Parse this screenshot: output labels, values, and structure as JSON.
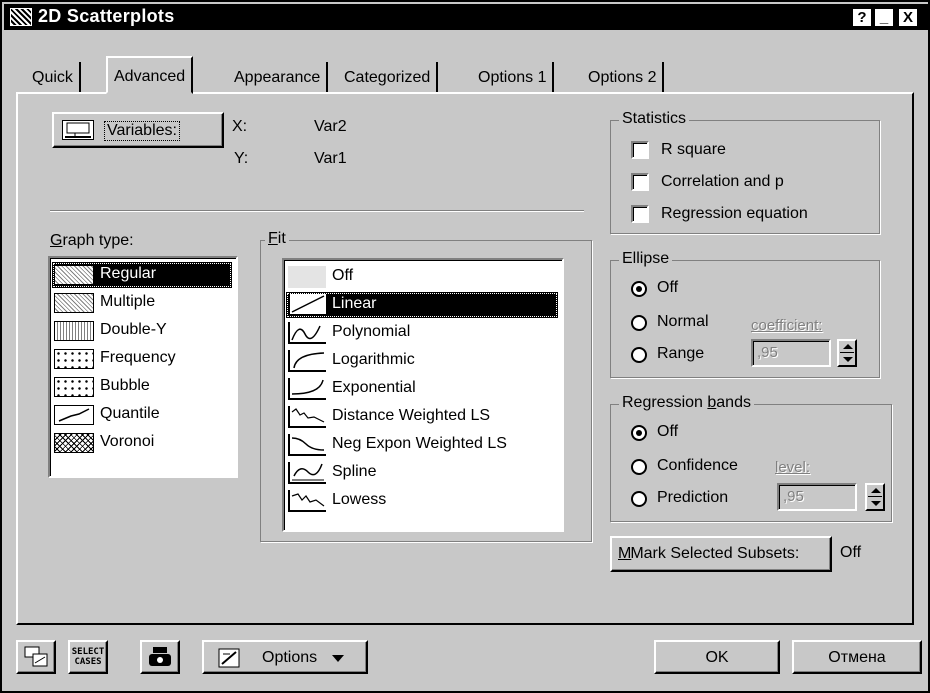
{
  "window": {
    "title": "2D Scatterplots",
    "help": "?",
    "minimize": "_",
    "close": "X"
  },
  "tabs": [
    {
      "label": "Quick",
      "active": false
    },
    {
      "label": "Advanced",
      "active": true
    },
    {
      "label": "Appearance",
      "active": false
    },
    {
      "label": "Categorized",
      "active": false
    },
    {
      "label": "Options 1",
      "active": false
    },
    {
      "label": "Options 2",
      "active": false
    }
  ],
  "variables": {
    "button_label": "Variables:",
    "x_label": "X:",
    "x_value": "Var2",
    "y_label": "Y:",
    "y_value": "Var1"
  },
  "graph_type": {
    "label": "Graph type:",
    "items": [
      "Regular",
      "Multiple",
      "Double-Y",
      "Frequency",
      "Bubble",
      "Quantile",
      "Voronoi"
    ],
    "selected": "Regular"
  },
  "fit": {
    "label": "Fit",
    "items": [
      "Off",
      "Linear",
      "Polynomial",
      "Logarithmic",
      "Exponential",
      "Distance Weighted LS",
      "Neg Expon Weighted LS",
      "Spline",
      "Lowess"
    ],
    "selected": "Linear"
  },
  "statistics": {
    "label": "Statistics",
    "items": [
      {
        "label": "R square",
        "checked": false
      },
      {
        "label": "Correlation and p",
        "checked": false
      },
      {
        "label": "Regression equation",
        "checked": false
      }
    ]
  },
  "ellipse": {
    "label": "Ellipse",
    "options": [
      "Off",
      "Normal",
      "Range"
    ],
    "selected": "Off",
    "coefficient_label": "coefficient:",
    "coefficient_value": ",95"
  },
  "regression_bands": {
    "label": "Regression bands",
    "options": [
      "Off",
      "Confidence",
      "Prediction"
    ],
    "selected": "Off",
    "level_label": "level:",
    "level_value": ",95"
  },
  "mark_subsets": {
    "button_label": "Mark Selected Subsets:",
    "value": "Off"
  },
  "footer": {
    "select_cases_line1": "SELECT",
    "select_cases_line2": "CASES",
    "options_label": "Options",
    "ok_label": "OK",
    "cancel_label": "Отмена"
  }
}
